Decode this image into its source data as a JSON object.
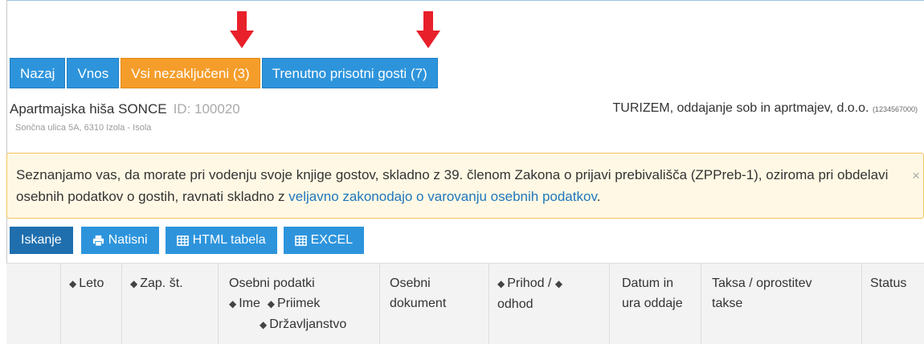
{
  "tabs": [
    {
      "label": "Nazaj"
    },
    {
      "label": "Vnos"
    },
    {
      "label": "Vsi nezaključeni (3)"
    },
    {
      "label": "Trenutno prisotni gosti (7)"
    }
  ],
  "business": {
    "name": "Apartmajska hiša SONCE",
    "id_label": "ID: 100020",
    "address": "Sončna ulica 5A, 6310 Izola - Isola"
  },
  "company": {
    "name": "TURIZEM, oddajanje sob in aprtmajev, d.o.o.",
    "id": "(1234567000)"
  },
  "notice": {
    "text": "Seznanjamo vas, da morate pri vodenju svoje knjige gostov, skladno z 39. členom Zakona o prijavi prebivališča (ZPPreb-1), oziroma pri obdelavi osebnih podatkov o gostih, ravnati skladno z ",
    "link": "veljavno zakonodajo o varovanju osebnih podatkov",
    "end": ".",
    "close": "×"
  },
  "toolbar": {
    "search": "Iskanje",
    "print": "Natisni",
    "html_table": "HTML tabela",
    "excel": "EXCEL"
  },
  "table": {
    "columns": {
      "year": "Leto",
      "seq_no": "Zap. št.",
      "personal": "Osebni podatki",
      "first_name": "Ime",
      "last_name": "Priimek",
      "citizenship": "Državljanstvo",
      "document": "Osebni dokument",
      "arrival": "Prihod /",
      "departure": "odhod",
      "rent_datetime": "Datum in ura oddaje",
      "tax": "Taksa / oprostitev takse",
      "status": "Status"
    }
  },
  "icons": {
    "sort": "sort-icon",
    "print": "print-icon",
    "table": "table-icon",
    "arrow": "arrow-down-icon"
  },
  "colors": {
    "primary": "#2d94dc",
    "primary_dark": "#1f6fae",
    "orange": "#f59d2a",
    "arrow": "#e8202a",
    "notice_bg": "#fff8e4",
    "notice_border": "#f4c55f",
    "link": "#1f77bd"
  }
}
